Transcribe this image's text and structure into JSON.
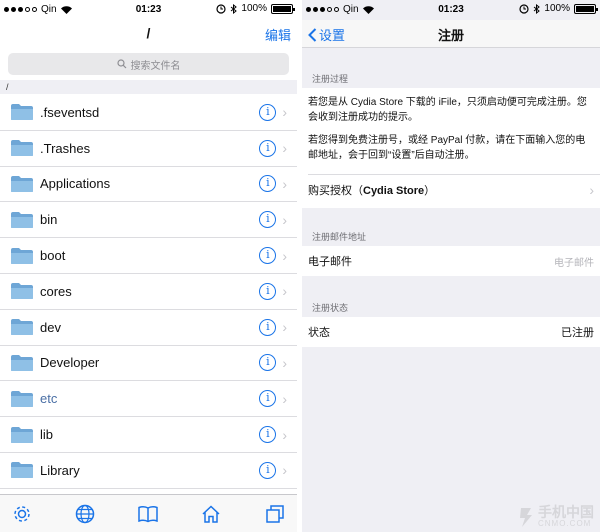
{
  "left": {
    "status": {
      "carrier": "Qin",
      "time": "01:23",
      "battery": "100%"
    },
    "nav": {
      "title": "/",
      "edit": "编辑"
    },
    "search": {
      "placeholder": "搜索文件名"
    },
    "path": "/",
    "files": [
      {
        "name": ".fseventsd",
        "tinted": false
      },
      {
        "name": ".Trashes",
        "tinted": false
      },
      {
        "name": "Applications",
        "tinted": false
      },
      {
        "name": "bin",
        "tinted": false
      },
      {
        "name": "boot",
        "tinted": false
      },
      {
        "name": "cores",
        "tinted": false
      },
      {
        "name": "dev",
        "tinted": false
      },
      {
        "name": "Developer",
        "tinted": false
      },
      {
        "name": "etc",
        "tinted": true
      },
      {
        "name": "lib",
        "tinted": false
      },
      {
        "name": "Library",
        "tinted": false
      }
    ],
    "tabs": [
      "gear-icon",
      "globe-icon",
      "book-icon",
      "home-icon",
      "windows-icon"
    ]
  },
  "right": {
    "status": {
      "carrier": "Qin",
      "time": "01:23",
      "battery": "100%"
    },
    "nav": {
      "back": "设置",
      "title": "注册"
    },
    "section1": {
      "header": "注册过程",
      "para1": "若您是从 Cydia Store 下载的 iFile，只须启动便可完成注册。您会收到注册成功的提示。",
      "para2": "若您得到免费注册号，或经 PayPal 付款，请在下面输入您的电邮地址，会于回到“设置”后自动注册。",
      "purchase_label": "购买授权（",
      "purchase_bold": "Cydia Store",
      "purchase_close": "）"
    },
    "section2": {
      "header": "注册邮件地址",
      "label": "电子邮件",
      "placeholder": "电子邮件"
    },
    "section3": {
      "header": "注册状态",
      "label": "状态",
      "value": "已注册"
    },
    "watermark": {
      "text": "手机中国",
      "sub": "CNMO.COM"
    }
  },
  "colors": {
    "accent": "#1a74e8",
    "folder": "#7fb3dd",
    "background": "#efeff4"
  }
}
